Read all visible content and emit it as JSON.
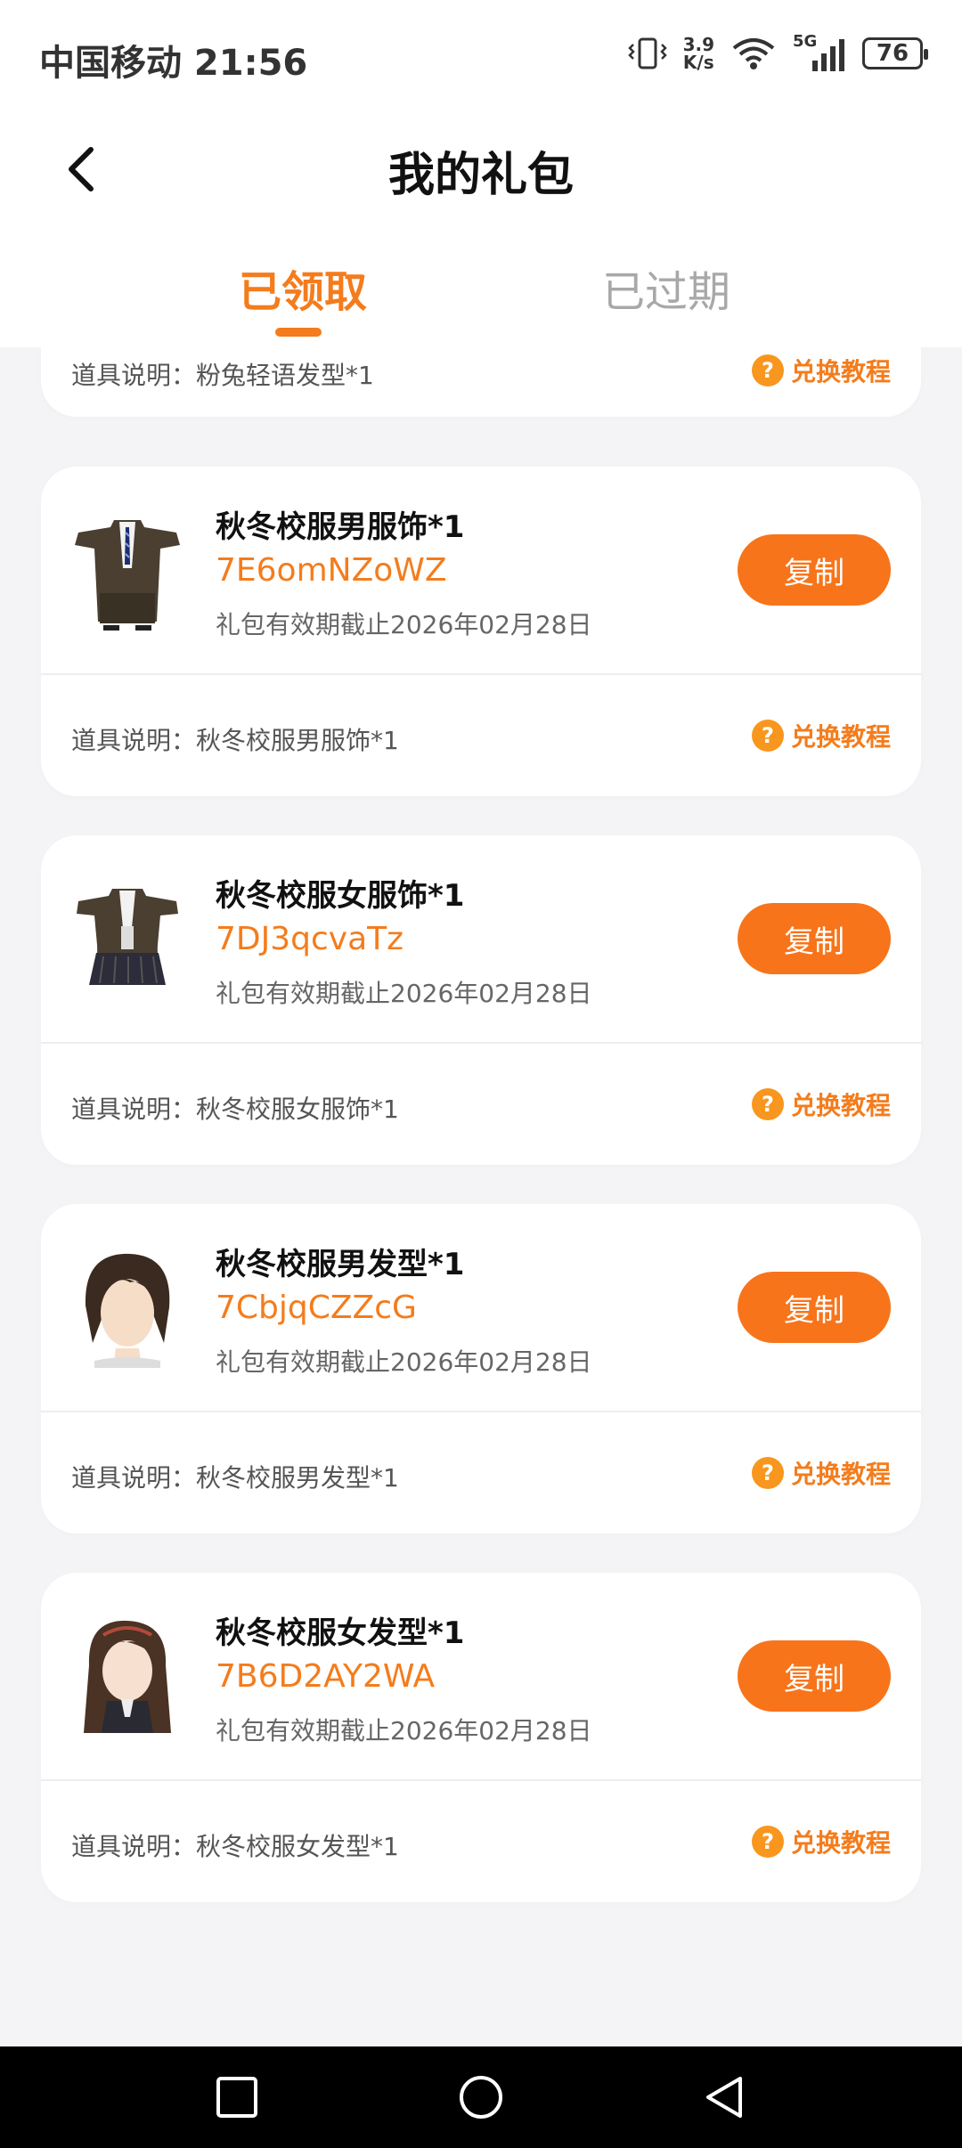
{
  "status_bar": {
    "carrier_time": "中国移动 21:56",
    "net_speed_value": "3.9",
    "net_speed_unit": "K/s",
    "network_type": "5G",
    "battery": "76",
    "icons": [
      "vibrate-icon",
      "wifi-icon",
      "signal-icon",
      "battery-icon"
    ]
  },
  "header": {
    "title": "我的礼包",
    "tabs": [
      {
        "label": "已领取",
        "active": true
      },
      {
        "label": "已过期",
        "active": false
      }
    ],
    "accent_color": "#f47c1c"
  },
  "partial_card": {
    "description": "道具说明：粉兔轻语发型*1",
    "guide_label": "兑换教程"
  },
  "gifts": [
    {
      "name": "秋冬校服男服饰*1",
      "code": "7E6omNZoWZ",
      "expiry": "礼包有效期截止2026年02月28日",
      "copy_label": "复制",
      "description": "道具说明：秋冬校服男服饰*1",
      "guide_label": "兑换教程",
      "thumb": "male-uniform-image"
    },
    {
      "name": "秋冬校服女服饰*1",
      "code": "7DJ3qcvaTz",
      "expiry": "礼包有效期截止2026年02月28日",
      "copy_label": "复制",
      "description": "道具说明：秋冬校服女服饰*1",
      "guide_label": "兑换教程",
      "thumb": "female-uniform-image"
    },
    {
      "name": "秋冬校服男发型*1",
      "code": "7CbjqCZZcG",
      "expiry": "礼包有效期截止2026年02月28日",
      "copy_label": "复制",
      "description": "道具说明：秋冬校服男发型*1",
      "guide_label": "兑换教程",
      "thumb": "male-hairstyle-image"
    },
    {
      "name": "秋冬校服女发型*1",
      "code": "7B6D2AY2WA",
      "expiry": "礼包有效期截止2026年02月28日",
      "copy_label": "复制",
      "description": "道具说明：秋冬校服女发型*1",
      "guide_label": "兑换教程",
      "thumb": "female-hairstyle-image"
    }
  ],
  "help_icon_glyph": "?",
  "nav_icons": [
    "recent-apps-icon",
    "home-icon",
    "back-nav-icon"
  ]
}
